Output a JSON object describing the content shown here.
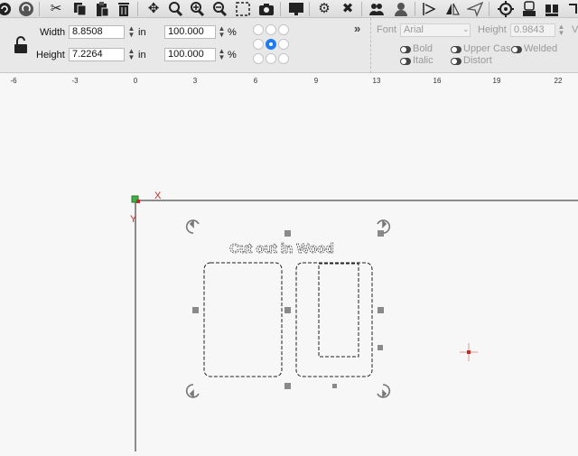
{
  "toolbar": {
    "icons": [
      "circle-arrow-icon",
      "redo-icon",
      "cut-icon",
      "copy-icon",
      "paste-icon",
      "trash-icon",
      "move-icon",
      "zoom-fit-icon",
      "zoom-in-icon",
      "zoom-out-icon",
      "selection-box-icon",
      "camera-icon",
      "monitor-icon",
      "tools-icon",
      "wrench-icon",
      "users-icon",
      "user-icon",
      "align-icon",
      "mirror-icon",
      "send-icon",
      "target-icon",
      "settings-icon",
      "camera-settings-icon"
    ]
  },
  "size": {
    "width_label": "Width",
    "width_value": "8.8508",
    "height_label": "Height",
    "height_value": "7.2264",
    "unit": "in",
    "width_scale": "100.000",
    "height_scale": "100.000",
    "percent": "%"
  },
  "font": {
    "more": "»",
    "label": "Font",
    "value": "Arial",
    "height_label": "Height",
    "height_value": "0.9843",
    "bold": "Bold",
    "upper_case": "Upper Cas",
    "welded": "Welded",
    "italic": "Italic",
    "distort": "Distort",
    "edge_letter": "V"
  },
  "ruler": {
    "ticks": [
      "-6",
      "-3",
      "0",
      "3",
      "6",
      "9",
      "13",
      "16",
      "19",
      "22"
    ]
  },
  "canvas": {
    "x_axis": "X",
    "y_axis": "Y",
    "text": "Cut out in Wood"
  },
  "colors": {
    "accent": "#1e7bf2",
    "origin": "#c62828",
    "origin_marker": "#3cb043"
  }
}
